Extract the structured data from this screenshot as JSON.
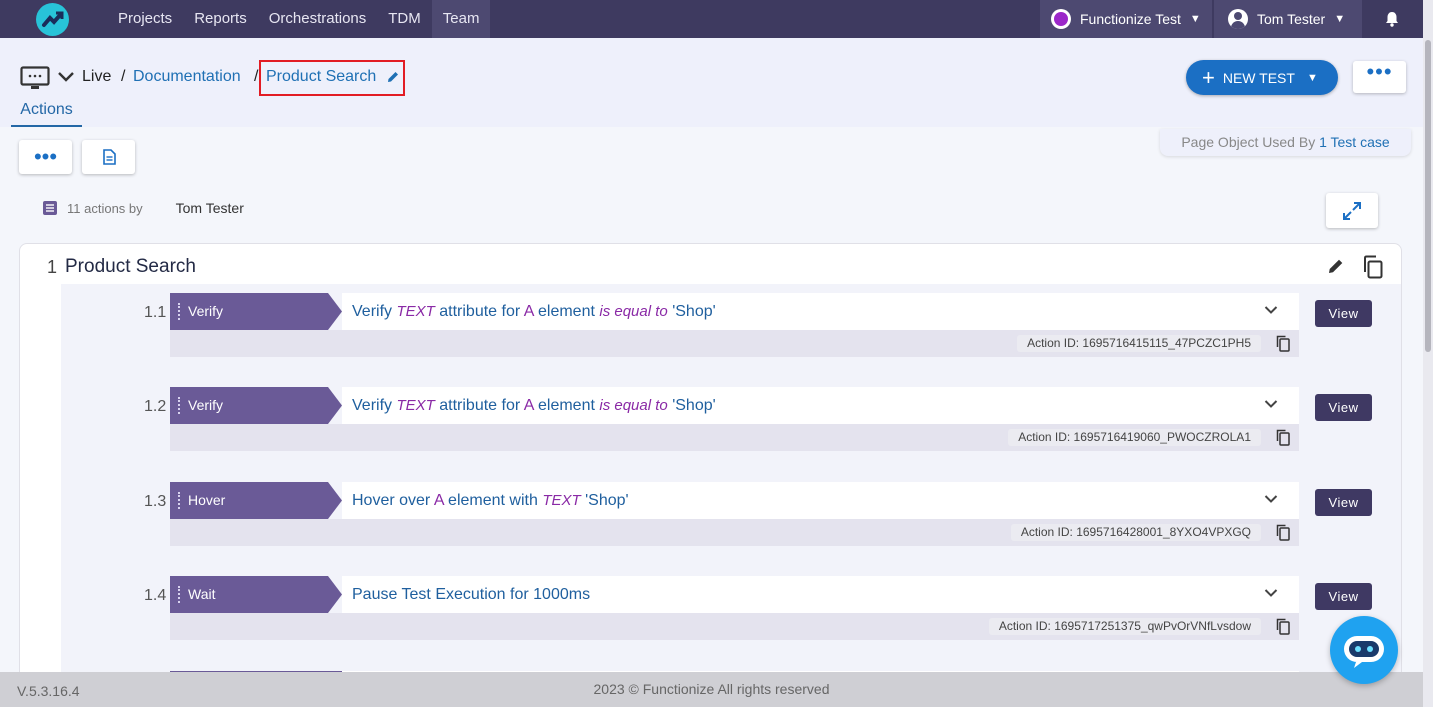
{
  "nav": {
    "items": [
      "Projects",
      "Reports",
      "Orchestrations",
      "TDM",
      "Team"
    ],
    "active_index": 4,
    "org": "Functionize Test",
    "user": "Tom Tester"
  },
  "breadcrumb": {
    "root": "Live",
    "sep": "/",
    "folder": "Documentation",
    "current": "Product Search"
  },
  "tabs": {
    "actions": "Actions"
  },
  "buttons": {
    "new_test": "NEW TEST",
    "view": "View"
  },
  "page_object": {
    "prefix": "Page Object Used By",
    "link": "1 Test case"
  },
  "meta": {
    "count": "11 actions by",
    "author": "Tom Tester"
  },
  "step": {
    "number": "1",
    "title": "Product Search"
  },
  "actions": [
    {
      "num": "1.1",
      "type": "Verify",
      "parts": [
        "Verify ",
        "TEXT",
        " attribute for ",
        "A",
        "  element ",
        "is equal to",
        "  'Shop'"
      ],
      "id": "Action ID: 1695716415115_47PCZC1PH5"
    },
    {
      "num": "1.2",
      "type": "Verify",
      "parts": [
        "Verify ",
        "TEXT",
        " attribute for ",
        "A",
        "  element ",
        "is equal to",
        "  'Shop'"
      ],
      "id": "Action ID: 1695716419060_PWOCZROLA1"
    },
    {
      "num": "1.3",
      "type": "Hover",
      "parts": [
        "Hover over ",
        "A",
        "  element with ",
        "TEXT",
        "  'Shop'"
      ],
      "id": "Action ID: 1695716428001_8YXO4VPXGQ"
    },
    {
      "num": "1.4",
      "type": "Wait",
      "parts": [
        "Pause Test Execution for 1000ms"
      ],
      "id": "Action ID: 1695717251375_qwPvOrVNfLvsdow"
    }
  ],
  "footer": {
    "version": "V.5.3.16.4",
    "copyright": "2023 © Functionize All rights reserved"
  },
  "colors": {
    "nav_bg": "#3e3a60",
    "accent": "#1b6fc4",
    "action_label": "#6a5a97",
    "view_btn": "#3f3963",
    "highlight": "#e21c24"
  }
}
